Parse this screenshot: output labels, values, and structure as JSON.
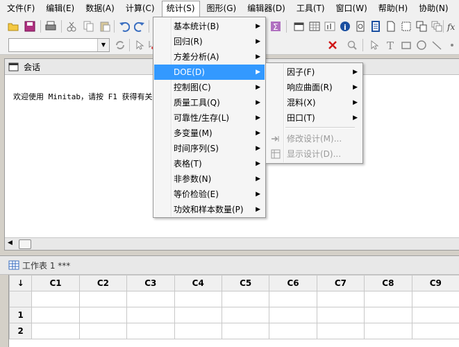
{
  "menubar": {
    "items": [
      "文件(F)",
      "编辑(E)",
      "数据(A)",
      "计算(C)",
      "统计(S)",
      "图形(G)",
      "编辑器(D)",
      "工具(T)",
      "窗口(W)",
      "帮助(H)",
      "协助(N)"
    ]
  },
  "session": {
    "title": "会话",
    "text": "欢迎使用 Minitab，请按 F1 获得有关"
  },
  "stats_menu": {
    "items": [
      {
        "label": "基本统计(B)"
      },
      {
        "label": "回归(R)"
      },
      {
        "label": "方差分析(A)"
      },
      {
        "label": "DOE(D)"
      },
      {
        "label": "控制图(C)"
      },
      {
        "label": "质量工具(Q)"
      },
      {
        "label": "可靠性/生存(L)"
      },
      {
        "label": "多变量(M)"
      },
      {
        "label": "时间序列(S)"
      },
      {
        "label": "表格(T)"
      },
      {
        "label": "非参数(N)"
      },
      {
        "label": "等价检验(E)"
      },
      {
        "label": "功效和样本数量(P)"
      }
    ]
  },
  "doe_submenu": {
    "items": [
      {
        "label": "因子(F)"
      },
      {
        "label": "响应曲面(R)"
      },
      {
        "label": "混料(X)"
      },
      {
        "label": "田口(T)"
      },
      {
        "label": "修改设计(M)..."
      },
      {
        "label": "显示设计(D)..."
      }
    ]
  },
  "worksheet": {
    "title": "工作表 1 ***",
    "corner": "↓",
    "columns": [
      "C1",
      "C2",
      "C3",
      "C4",
      "C5",
      "C6",
      "C7",
      "C8",
      "C9"
    ],
    "rows": [
      "1",
      "2"
    ]
  },
  "colors": {
    "highlight": "#3399ff",
    "disabled": "#9a9a9a"
  }
}
